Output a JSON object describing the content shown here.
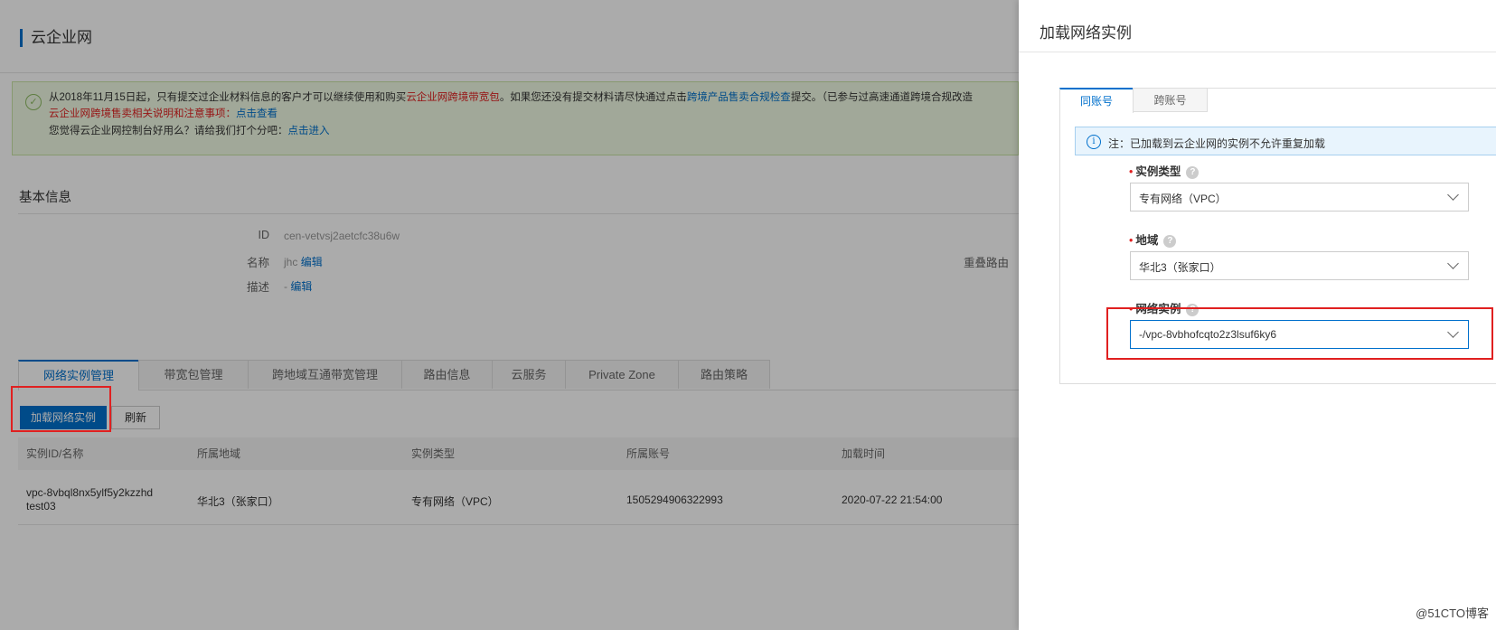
{
  "page": {
    "title": "云企业网",
    "notice": {
      "line1_a": "从2018年11月15日起，只有提交过企业材料信息的客户才可以继续使用和购买",
      "line1_b": "云企业网跨境带宽包",
      "line1_c": "。如果您还没有提交材料请尽快通过点击",
      "line1_d": "跨境产品售卖合规检查",
      "line1_e": "提交。（已参与过高速通道跨境合规改造",
      "line2_a": "云企业网跨境售卖相关说明和注意事项：",
      "line2_b": "点击查看",
      "line3_a": "您觉得云企业网控制台好用么？请给我们打个分吧：",
      "line3_b": "点击进入"
    },
    "basic_info": {
      "title": "基本信息",
      "id_label": "ID",
      "id_value": "cen-vetvsj2aetcfc38u6w",
      "name_label": "名称",
      "name_value": "jhc",
      "desc_label": "描述",
      "desc_value": "-",
      "edit_label": "编辑",
      "overlap_label": "重叠路由"
    },
    "tabs": [
      "网络实例管理",
      "带宽包管理",
      "跨地域互通带宽管理",
      "路由信息",
      "云服务",
      "Private Zone",
      "路由策略"
    ],
    "buttons": {
      "load": "加载网络实例",
      "refresh": "刷新"
    },
    "table": {
      "headers": [
        "实例ID/名称",
        "所属地域",
        "实例类型",
        "所属账号",
        "加载时间"
      ],
      "rows": [
        {
          "id": "vpc-8vbql8nx5ylf5y2kzzhd",
          "name": "test03",
          "region": "华北3（张家口）",
          "type": "专有网络（VPC）",
          "account": "1505294906322993",
          "time": "2020-07-22 21:54:00"
        }
      ]
    }
  },
  "drawer": {
    "title": "加载网络实例",
    "tabs": [
      "同账号",
      "跨账号"
    ],
    "info": "注：已加载到云企业网的实例不允许重复加载",
    "fields": {
      "instance_type": {
        "label": "实例类型",
        "value": "专有网络（VPC）"
      },
      "region": {
        "label": "地域",
        "value": "华北3（张家口）"
      },
      "network_instance": {
        "label": "网络实例",
        "value": "-/vpc-8vbhofcqto2z3lsuf6ky6"
      }
    }
  },
  "watermark": "@51CTO博客",
  "colors": {
    "accent": "#0070cc",
    "highlight": "#e02020",
    "notice_bg": "#f1fbe4"
  }
}
